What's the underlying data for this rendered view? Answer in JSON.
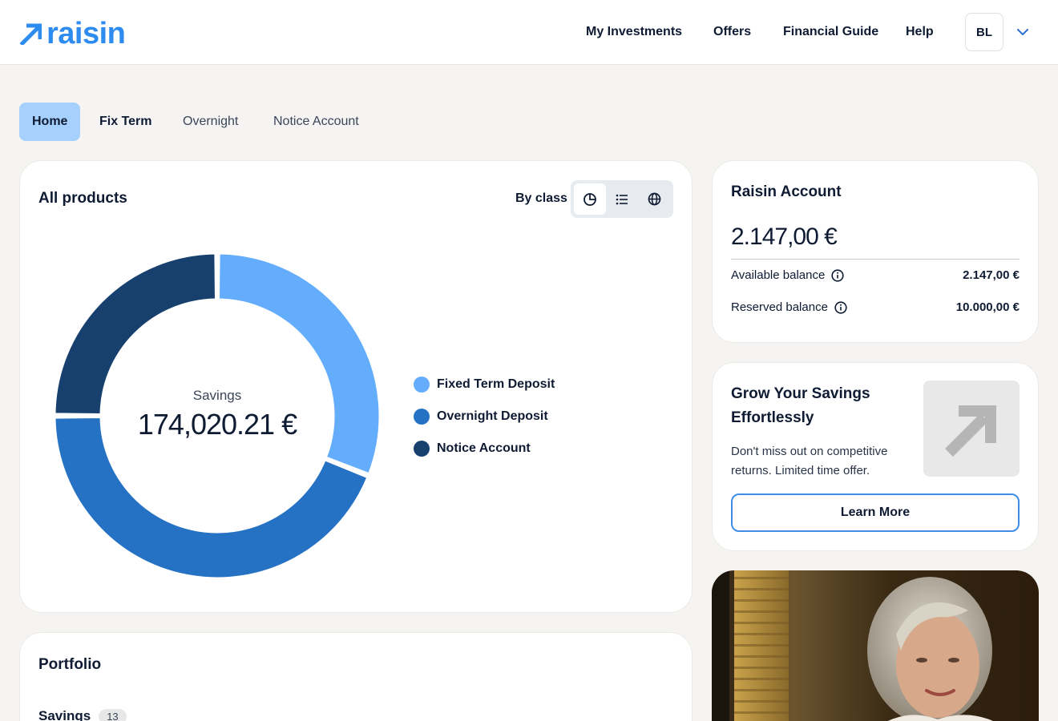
{
  "header": {
    "logo_text": "raisin",
    "nav": [
      "My Investments",
      "Offers",
      "Financial Guide",
      "Help"
    ],
    "avatar_initials": "BL"
  },
  "tabs": [
    {
      "label": "Home",
      "active": true
    },
    {
      "label": "Fix Term",
      "active": false
    },
    {
      "label": "Overnight",
      "active": false
    },
    {
      "label": "Notice Account",
      "active": false
    }
  ],
  "products": {
    "title": "All products",
    "view_label": "By class",
    "center_label": "Savings",
    "center_value": "174,020.21 €"
  },
  "chart_data": {
    "type": "pie",
    "categories": [
      "Fixed Term Deposit",
      "Overnight Deposit",
      "Notice Account"
    ],
    "values": [
      31,
      44,
      25
    ],
    "colors": [
      "#63adfc",
      "#2572c5",
      "#17406f"
    ]
  },
  "account": {
    "title": "Raisin Account",
    "amount": "2.147,00 €",
    "available_label": "Available balance",
    "available_value": "2.147,00 €",
    "reserved_label": "Reserved balance",
    "reserved_value": "10.000,00 €"
  },
  "promo": {
    "title": "Grow Your Savings Effortlessly",
    "text": "Don't miss out on competitive returns. Limited time offer.",
    "button": "Learn More"
  },
  "portfolio": {
    "title": "Portfolio",
    "sub_label": "Savings",
    "count": "13"
  },
  "colors": {
    "brand": "#2e8cf0",
    "tab_active": "#a6d1ff",
    "text": "#0e1b33"
  }
}
